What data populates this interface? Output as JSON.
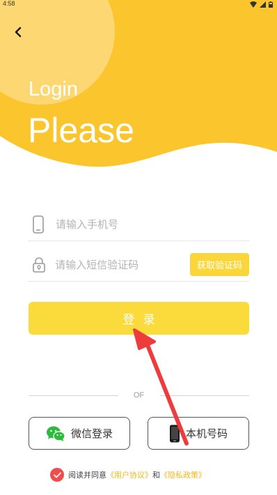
{
  "status_bar": {
    "time": "4:58"
  },
  "header": {
    "login": "Login",
    "please": "Please"
  },
  "form": {
    "phone_placeholder": "请输入手机号",
    "code_placeholder": "请输入短信验证码",
    "get_code_label": "获取验证码",
    "login_label": "登录"
  },
  "divider": {
    "label": "OF"
  },
  "alt_login": {
    "wechat_label": "微信登录",
    "phone_label": "本机号码"
  },
  "agreement": {
    "prefix": "阅读并同意",
    "user_agreement": "《用户协议》",
    "and": "和",
    "privacy_policy": "《隐私政策》"
  },
  "colors": {
    "primary_yellow": "#fbc52e",
    "button_yellow": "#fbdb3c",
    "arrow_red": "#ee3b3b",
    "check_red": "#ef4d4d",
    "link_orange": "#f0b81a"
  }
}
